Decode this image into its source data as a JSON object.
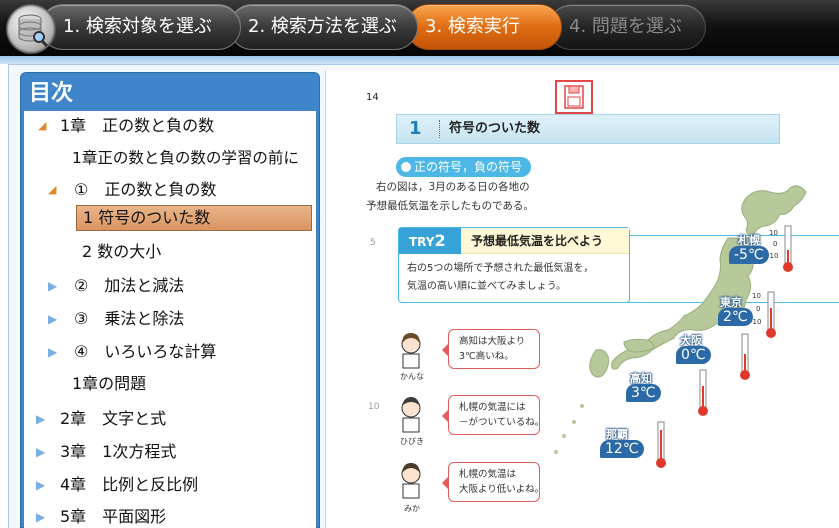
{
  "steps": [
    {
      "label": "1. 検索対象を選ぶ",
      "state": "done"
    },
    {
      "label": "2. 検索方法を選ぶ",
      "state": "done"
    },
    {
      "label": "3. 検索実行",
      "state": "active"
    },
    {
      "label": "4. 問題を選ぶ",
      "state": "disabled"
    }
  ],
  "colors": {
    "active_step": "#e06d14",
    "toc_header": "#3e86c9",
    "selection": "#d99461",
    "accent": "#4db8e6"
  },
  "toc": {
    "title": "目次",
    "items": [
      {
        "label": "1章　正の数と負の数",
        "expand": "open"
      },
      {
        "label": "1章正の数と負の数の学習の前に",
        "expand": "none"
      },
      {
        "label": "①　正の数と負の数",
        "expand": "open"
      },
      {
        "label": "1 符号のついた数",
        "expand": "none",
        "selected": true
      },
      {
        "label": "2 数の大小",
        "expand": "none"
      },
      {
        "label": "②　加法と減法",
        "expand": "closed"
      },
      {
        "label": "③　乗法と除法",
        "expand": "closed"
      },
      {
        "label": "④　いろいろな計算",
        "expand": "closed"
      },
      {
        "label": "1章の問題",
        "expand": "none"
      },
      {
        "label": "2章　文字と式",
        "expand": "closed"
      },
      {
        "label": "3章　1次方程式",
        "expand": "closed"
      },
      {
        "label": "4章　比例と反比例",
        "expand": "closed"
      },
      {
        "label": "5章　平面図形",
        "expand": "closed"
      }
    ]
  },
  "page": {
    "page_number": "14",
    "line_marks": [
      "5",
      "10"
    ],
    "section_number": "1",
    "section_title": "符号のついた数",
    "pill": "正の符号，負の符号",
    "intro": [
      "右の図は，3月のある日の各地の",
      "予想最低気温を示したものである。"
    ],
    "try": {
      "badge": "TRY",
      "badge_num": "2",
      "title": "予想最低気温を比べよう",
      "body": [
        "右の5つの場所で予想された最低気温を，",
        "気温の高い順に並べてみましょう。"
      ]
    },
    "dialog": [
      {
        "name": "かんな",
        "text": [
          "高知は大阪より",
          "3℃高いね。"
        ]
      },
      {
        "name": "ひびき",
        "text": [
          "札幌の気温には",
          "－がついているね。"
        ]
      },
      {
        "name": "みか",
        "text": [
          "札幌の気温は",
          "大阪より低いよね。"
        ]
      }
    ],
    "cities": [
      {
        "name": "札幌",
        "temp": "-5℃",
        "value": -5
      },
      {
        "name": "東京",
        "temp": "2℃",
        "value": 2
      },
      {
        "name": "大阪",
        "temp": "0℃",
        "value": 0
      },
      {
        "name": "高知",
        "temp": "3℃",
        "value": 3
      },
      {
        "name": "那覇",
        "temp": "12℃",
        "value": 12
      }
    ],
    "thermo_ticks": [
      "10",
      "0",
      "-10"
    ]
  }
}
